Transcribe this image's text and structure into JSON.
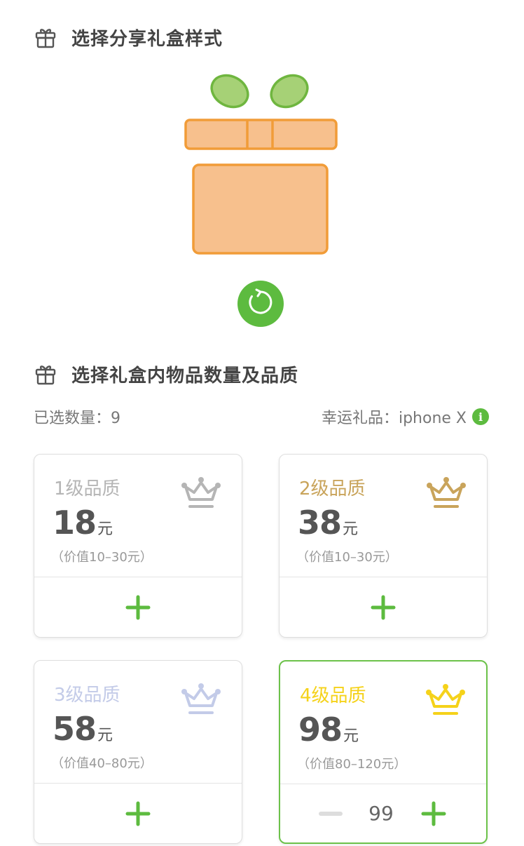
{
  "section1": {
    "title": "选择分享礼盒样式"
  },
  "section2": {
    "title": "选择礼盒内物品数量及品质"
  },
  "stats": {
    "selected_label": "已选数量：9",
    "lucky_label": "幸运礼品：iphone X",
    "info_icon": "i"
  },
  "cards": [
    {
      "level": "1级品质",
      "price": "18",
      "unit": "元",
      "range": "（价值10–30元）",
      "color": "#b5b5b5",
      "selected": false
    },
    {
      "level": "2级品质",
      "price": "38",
      "unit": "元",
      "range": "（价值10–30元）",
      "color": "#c9a45b",
      "selected": false
    },
    {
      "level": "3级品质",
      "price": "58",
      "unit": "元",
      "range": "（价值40–80元）",
      "color": "#c3cbe8",
      "selected": false
    },
    {
      "level": "4级品质",
      "price": "98",
      "unit": "元",
      "range": "（价值80–120元）",
      "color": "#f5d21a",
      "selected": true,
      "quantity": "99"
    }
  ],
  "colors": {
    "accent": "#5dbb3f",
    "box_fill": "#f7c08d",
    "box_stroke": "#f19c38",
    "bow_fill": "#a6d176",
    "bow_stroke": "#6fb63f"
  },
  "icons": {
    "title_icon": "gift-icon",
    "refresh": "refresh-icon",
    "plus": "plus-icon",
    "minus": "minus-icon",
    "crown": "crown-icon"
  }
}
